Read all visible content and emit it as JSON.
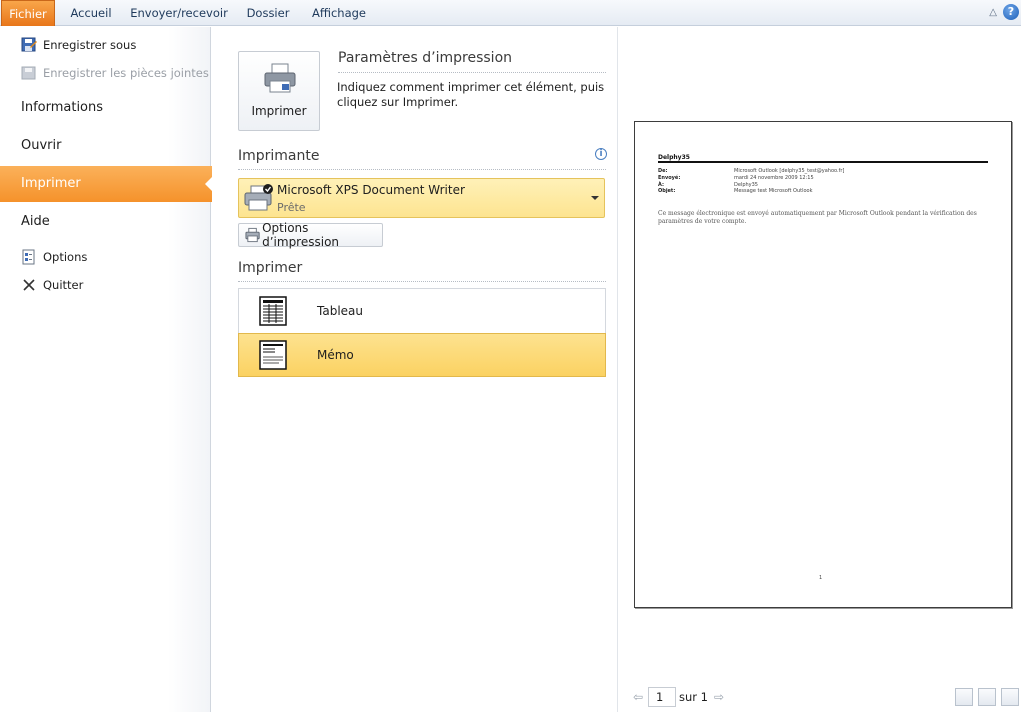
{
  "ribbon": {
    "tabs": [
      {
        "label": "Fichier"
      },
      {
        "label": "Accueil"
      },
      {
        "label": "Envoyer/recevoir"
      },
      {
        "label": "Dossier"
      },
      {
        "label": "Affichage"
      }
    ],
    "help_glyph": "?"
  },
  "nav": {
    "save_as": "Enregistrer sous",
    "save_attachments": "Enregistrer les pièces jointes",
    "info": "Informations",
    "open": "Ouvrir",
    "print": "Imprimer",
    "help": "Aide",
    "options": "Options",
    "quit": "Quitter"
  },
  "print_panel": {
    "print_button": "Imprimer",
    "settings_title": "Paramètres d’impression",
    "settings_desc": "Indiquez comment imprimer cet élément, puis cliquez sur Imprimer.",
    "printer_title": "Imprimante",
    "printer_name": "Microsoft XPS Document Writer",
    "printer_status": "Prête",
    "options_button": "Options d’impression",
    "style_title": "Imprimer",
    "styles": [
      {
        "label": "Tableau",
        "selected": false
      },
      {
        "label": "Mémo",
        "selected": true
      }
    ]
  },
  "preview": {
    "title": "Delphy35",
    "fields": [
      {
        "label": "De:",
        "value": "Microsoft Outlook [delphy35_test@yahoo.fr]"
      },
      {
        "label": "Envoyé:",
        "value": "mardi 24 novembre 2009 12:15"
      },
      {
        "label": "À:",
        "value": "Delphy35"
      },
      {
        "label": "Objet:",
        "value": "Message test Microsoft Outlook"
      }
    ],
    "body": "Ce message électronique est envoyé automatiquement par Microsoft Outlook pendant la vérification des paramètres de votre compte.",
    "page_number": "1",
    "pager_current": "1",
    "pager_total": "sur 1"
  },
  "colors": {
    "accent_orange": "#f5922b",
    "selected_yellow": "#fbd262",
    "ribbon_text": "#1e395b"
  }
}
